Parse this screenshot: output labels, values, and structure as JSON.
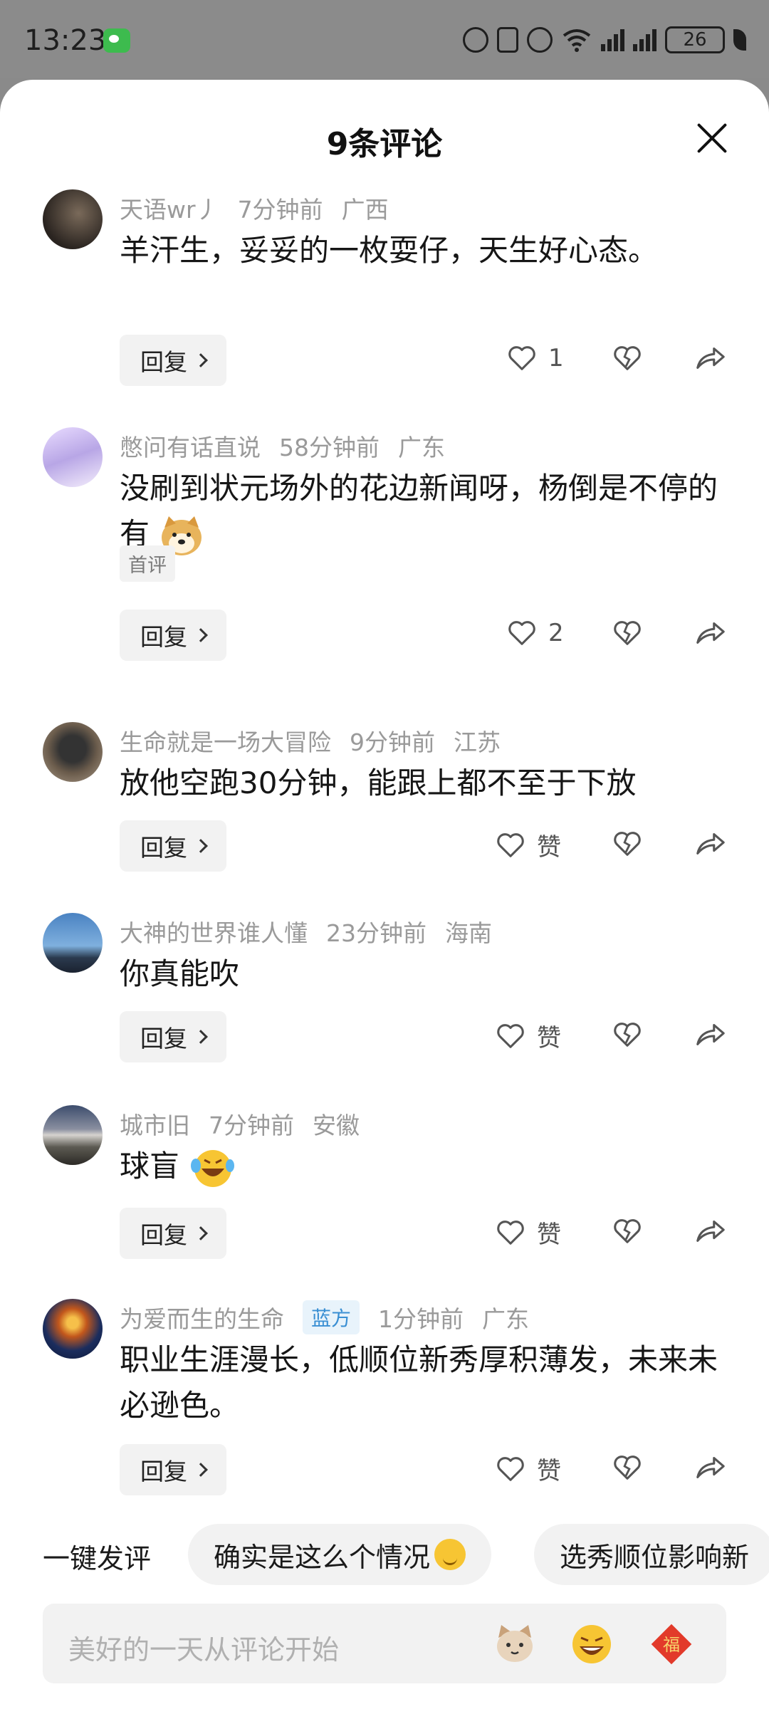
{
  "status_bar": {
    "time": "13:23",
    "battery": "26"
  },
  "sheet": {
    "title": "9条评论"
  },
  "actions": {
    "reply_label": "回复",
    "like_label": "赞"
  },
  "comments": [
    {
      "user": "天语wr丿",
      "time": "7分钟前",
      "location": "广西",
      "text": "羊汗生，妥妥的一枚耍仔，天生好心态。",
      "likes": "1"
    },
    {
      "user": "憋问有话直说",
      "time": "58分钟前",
      "location": "广东",
      "text": "没刷到状元场外的花边新闻呀，杨倒是不停的有",
      "emoji": "doge-emoji",
      "tag": "首评",
      "likes": "2"
    },
    {
      "user": "生命就是一场大冒险",
      "time": "9分钟前",
      "location": "江苏",
      "text": "放他空跑30分钟，能跟上都不至于下放",
      "likes": ""
    },
    {
      "user": "大神的世界谁人懂",
      "time": "23分钟前",
      "location": "海南",
      "text": "你真能吹",
      "likes": ""
    },
    {
      "user": "城市旧",
      "time": "7分钟前",
      "location": "安徽",
      "text": "球盲",
      "emoji": "laughing-crying-emoji",
      "likes": ""
    },
    {
      "user": "为爱而生的生命",
      "badge": "蓝方",
      "time": "1分钟前",
      "location": "广东",
      "text": "职业生涯漫长，低顺位新秀厚积薄发，未来未必逊色。",
      "likes": ""
    }
  ],
  "quick_comment": {
    "label": "一键发评",
    "chips": [
      "确实是这么个情况",
      "选秀顺位影响新"
    ]
  },
  "input": {
    "placeholder": "美好的一天从评论开始"
  },
  "colors": {
    "accent_badge": "#3a8fd3",
    "muted_text": "#9a9a9a",
    "chip_bg": "#f2f2f2"
  }
}
